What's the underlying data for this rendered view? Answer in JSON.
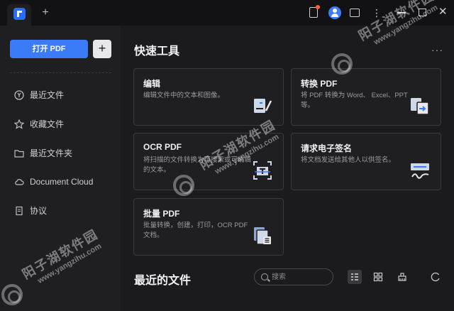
{
  "titlebar": {
    "new_tab": "+",
    "more": "⋮",
    "win_close": "✕"
  },
  "sidebar": {
    "open_button": "打开 PDF",
    "add_button": "+",
    "items": [
      {
        "label": "最近文件",
        "icon": "recent-icon"
      },
      {
        "label": "收藏文件",
        "icon": "star-icon"
      },
      {
        "label": "最近文件夹",
        "icon": "folder-icon"
      },
      {
        "label": "Document Cloud",
        "icon": "cloud-icon"
      },
      {
        "label": "协议",
        "icon": "document-icon"
      }
    ]
  },
  "main": {
    "quick_tools_title": "快速工具",
    "more": "···",
    "cards": [
      {
        "title": "编辑",
        "desc": "编辑文件中的文本和图像。",
        "icon": "edit-icon"
      },
      {
        "title": "转换 PDF",
        "desc": "将 PDF 转换为 Word、 Excel、PPT等。",
        "icon": "convert-icon"
      },
      {
        "title": "OCR PDF",
        "desc": "将扫描的文件转换为可搜索或可编辑的文本。",
        "icon": "ocr-icon"
      },
      {
        "title": "请求电子签名",
        "desc": "将文档发送给其他人以供签名。",
        "icon": "signature-icon"
      },
      {
        "title": "批量 PDF",
        "desc": "批量转换，创建，打印，OCR PDF 文档。",
        "icon": "batch-icon"
      }
    ],
    "recent_title": "最近的文件",
    "search_placeholder": "搜索"
  },
  "watermark": {
    "cn": "阳子湖软件园",
    "en": "www.yangzihu.com"
  },
  "colors": {
    "accent": "#3c7bf7",
    "background": "#1b1b1e",
    "panel": "#1f1f22",
    "notification": "#ff5a3c"
  }
}
